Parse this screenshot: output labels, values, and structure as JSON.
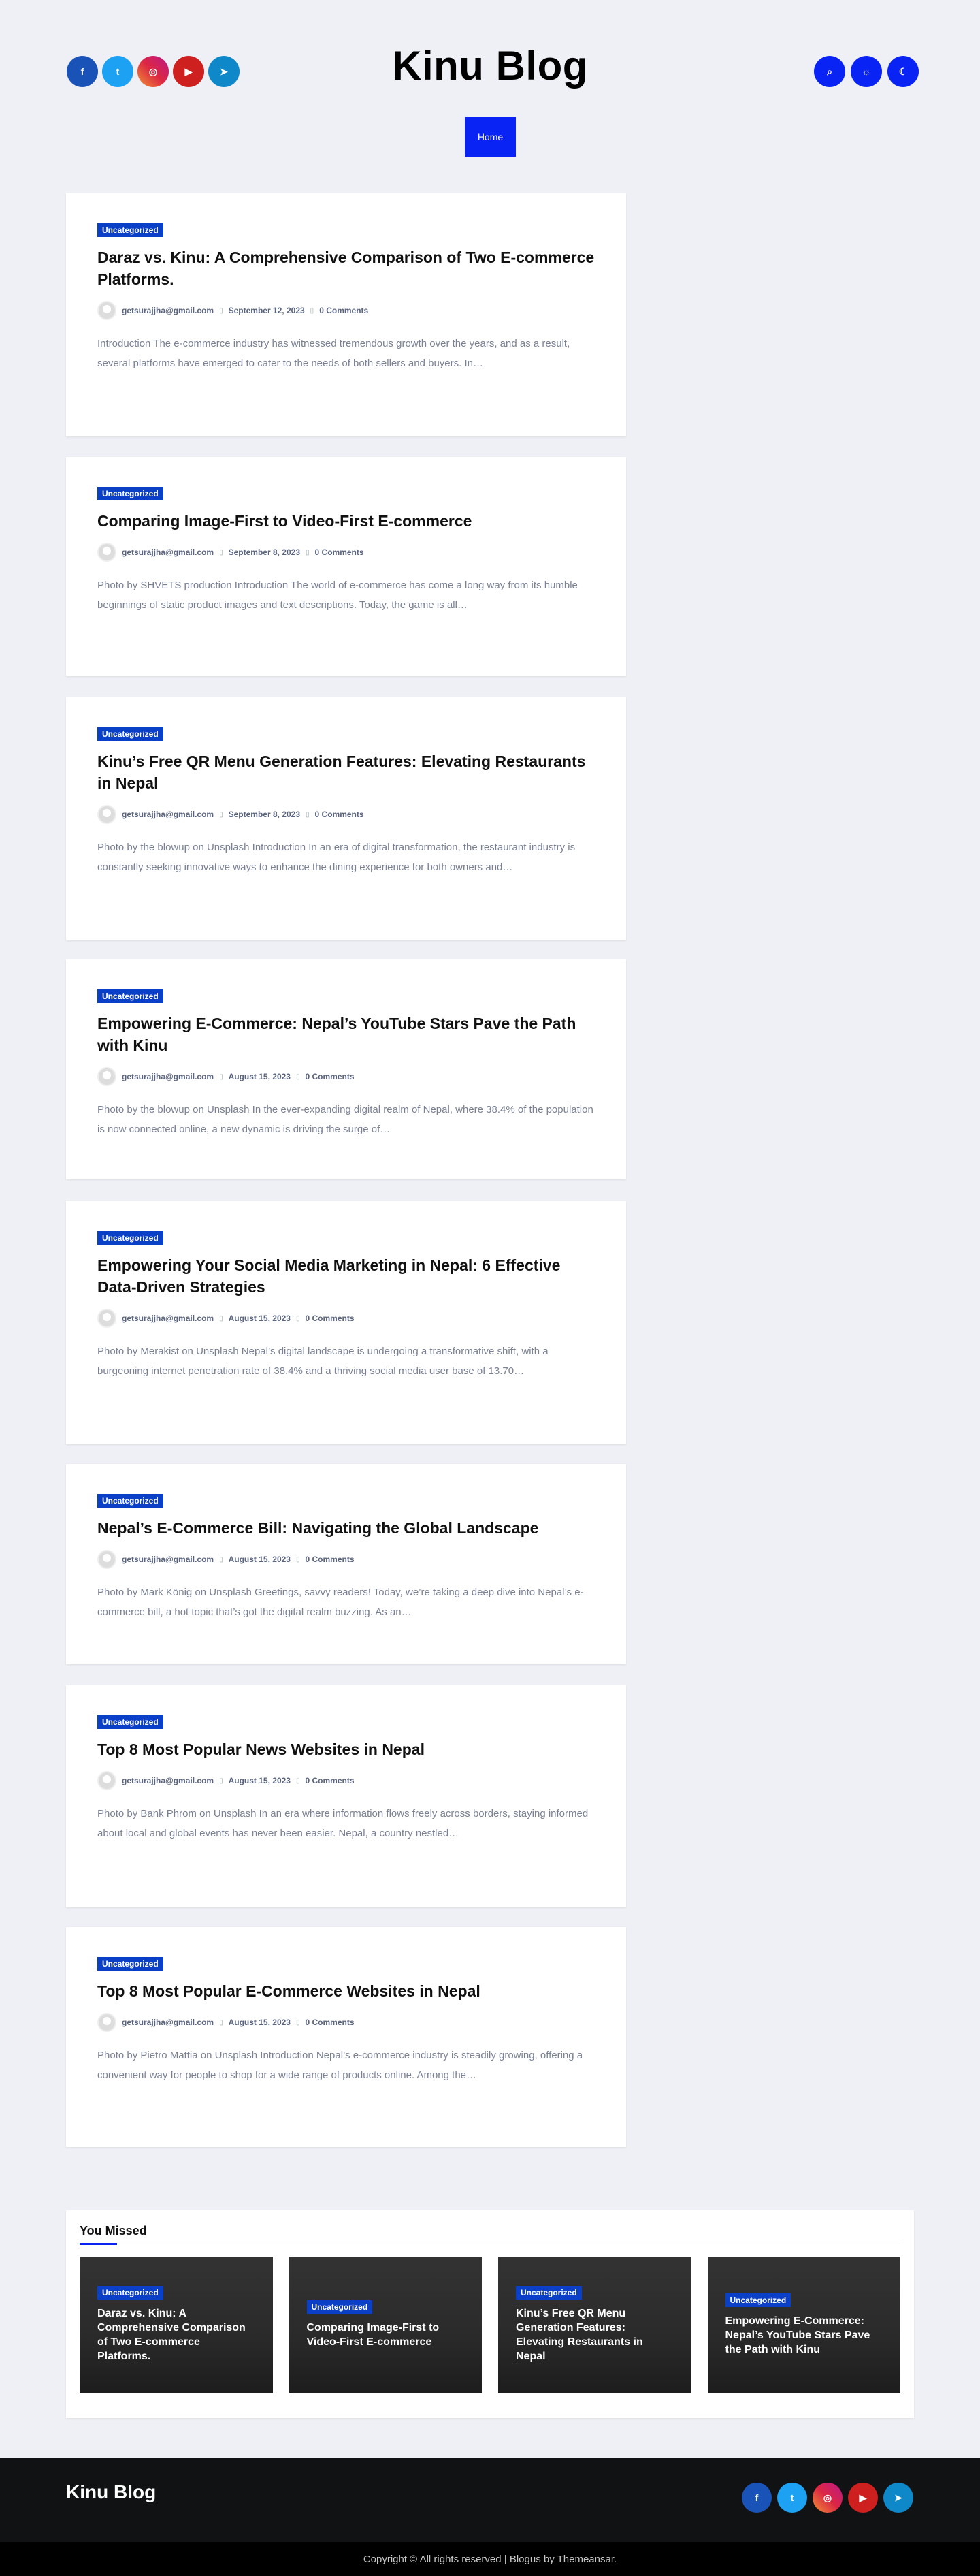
{
  "site": {
    "title": "Kinu Blog"
  },
  "social_icons": [
    "facebook-icon",
    "twitter-icon",
    "instagram-icon",
    "youtube-icon",
    "telegram-icon"
  ],
  "header_actions": [
    "search-icon",
    "light-mode-icon",
    "dark-mode-icon"
  ],
  "nav": {
    "items": [
      "Home"
    ]
  },
  "posts": [
    {
      "category": "Uncategorized",
      "title": "Daraz vs. Kinu: A Comprehensive Comparison of Two E-commerce Platforms.",
      "author": "getsurajjha@gmail.com",
      "date": "September 12, 2023",
      "comments": "0 Comments",
      "excerpt": "Introduction The e-commerce industry has witnessed tremendous growth over the years, and as a result, several platforms have emerged to cater to the needs of both sellers and buyers. In…"
    },
    {
      "category": "Uncategorized",
      "title": "Comparing Image-First to Video-First E-commerce",
      "author": "getsurajjha@gmail.com",
      "date": "September 8, 2023",
      "comments": "0 Comments",
      "excerpt": "Photo by SHVETS production Introduction The world of e-commerce has come a long way from its humble beginnings of static product images and text descriptions. Today, the game is all…"
    },
    {
      "category": "Uncategorized",
      "title": "Kinu’s Free QR Menu Generation Features: Elevating Restaurants in Nepal",
      "author": "getsurajjha@gmail.com",
      "date": "September 8, 2023",
      "comments": "0 Comments",
      "excerpt": "Photo by the blowup on Unsplash Introduction In an era of digital transformation, the restaurant industry is constantly seeking innovative ways to enhance the dining experience for both owners and…"
    },
    {
      "category": "Uncategorized",
      "title": "Empowering E-Commerce: Nepal’s YouTube Stars Pave the Path with Kinu",
      "author": "getsurajjha@gmail.com",
      "date": "August 15, 2023",
      "comments": "0 Comments",
      "excerpt": "Photo by the blowup on Unsplash In the ever-expanding digital realm of Nepal, where 38.4% of the population is now connected online, a new dynamic is driving the surge of…"
    },
    {
      "category": "Uncategorized",
      "title": "Empowering Your Social Media Marketing in Nepal: 6 Effective Data-Driven Strategies",
      "author": "getsurajjha@gmail.com",
      "date": "August 15, 2023",
      "comments": "0 Comments",
      "excerpt": "Photo by Merakist on Unsplash Nepal’s digital landscape is undergoing a transformative shift, with a burgeoning internet penetration rate of 38.4% and a thriving social media user base of 13.70…"
    },
    {
      "category": "Uncategorized",
      "title": "Nepal’s E-Commerce Bill: Navigating the Global Landscape",
      "author": "getsurajjha@gmail.com",
      "date": "August 15, 2023",
      "comments": "0 Comments",
      "excerpt": "Photo by Mark König on Unsplash Greetings, savvy readers! Today, we’re taking a deep dive into Nepal’s e-commerce bill, a hot topic that’s got the digital realm buzzing. As an…"
    },
    {
      "category": "Uncategorized",
      "title": "Top 8 Most Popular News Websites in Nepal",
      "author": "getsurajjha@gmail.com",
      "date": "August 15, 2023",
      "comments": "0 Comments",
      "excerpt": "Photo by Bank Phrom on Unsplash In an era where information flows freely across borders, staying informed about local and global events has never been easier. Nepal, a country nestled…"
    },
    {
      "category": "Uncategorized",
      "title": "Top 8 Most Popular E-Commerce Websites in Nepal",
      "author": "getsurajjha@gmail.com",
      "date": "August 15, 2023",
      "comments": "0 Comments",
      "excerpt": "Photo by Pietro Mattia on Unsplash Introduction Nepal’s e-commerce industry is steadily growing, offering a convenient way for people to shop for a wide range of products online. Among the…"
    }
  ],
  "you_missed": {
    "title": "You Missed",
    "cards": [
      {
        "category": "Uncategorized",
        "title": "Daraz vs. Kinu: A Comprehensive Comparison of Two E-commerce Platforms."
      },
      {
        "category": "Uncategorized",
        "title": "Comparing Image-First to Video-First E-commerce"
      },
      {
        "category": "Uncategorized",
        "title": "Kinu’s Free QR Menu Generation Features: Elevating Restaurants in Nepal"
      },
      {
        "category": "Uncategorized",
        "title": "Empowering E-Commerce: Nepal’s YouTube Stars Pave the Path with Kinu"
      }
    ]
  },
  "footer": {
    "title": "Kinu Blog",
    "copyright": "Copyright © All rights reserved | Blogus by Themeansar."
  }
}
